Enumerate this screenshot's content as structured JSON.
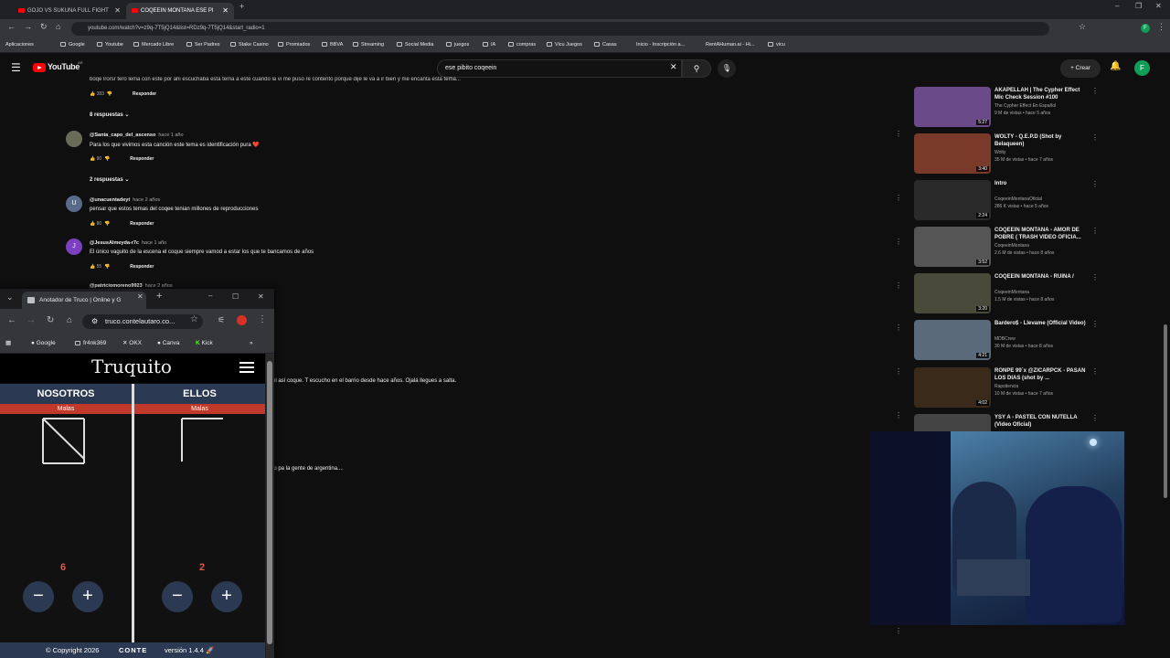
{
  "browser": {
    "tabs": [
      {
        "title": "GOJO VS SUKUNA FULL FIGHT"
      },
      {
        "title": "COQEEIN MONTANA ESE PI"
      }
    ],
    "url": "youtube.com/watch?v=z9q-7T5jQ14&list=RDz9q-7T5jQ14&start_radio=1",
    "bookmarks": [
      "Aplicaciones",
      "Google",
      "Youtube",
      "Mercado Libre",
      "Ser Padres",
      "Stake Casino",
      "Promiados",
      "BBVA",
      "Streaming",
      "Social Media",
      "juegos",
      "IA",
      "compras",
      "Vicu Juegos",
      "Casas",
      "Inicio - Inscripción a...",
      "RentAHuman.ai - Hi...",
      "vicu"
    ]
  },
  "youtube": {
    "logo_text": "YouTube",
    "logo_sup": "AR",
    "search_value": "ese pibito coqeein",
    "create_label": "Crear",
    "avatar_letter": "F",
    "accent": "#ff0000"
  },
  "comments": {
    "truncated_text": "boqe lrorsr tero lema con este por ahi escuchaba esta tema a este cuando la vi me puso re contento porque dije le va a ir bien y me encanta esta tema...",
    "top_likes": "383",
    "reply_label": "Responder",
    "items": [
      {
        "replies_label": "8 respuestas",
        "user": "@Santa_capo_del_ascenso",
        "time": "hace 1 año",
        "text": "Para los que vivimos esta canción este tema es identificación pura ❤️",
        "likes": "90",
        "avatar": "",
        "avatar_color": "#6b6b5a"
      },
      {
        "replies_label": "2 respuestas",
        "user": "@unacuentadeyt",
        "time": "hace 2 años",
        "text": "pensar que estos temas del coqee tenian millones de reproducciones",
        "likes": "80",
        "avatar": "U",
        "avatar_color": "#5a6b8a"
      },
      {
        "replies_label": "",
        "user": "@JesusAlmeyda-r7c",
        "time": "hace 1 año",
        "text": "El único vaguito de la escena el coque siempre vamod a estar los que te bancamos de años",
        "likes": "55",
        "avatar": "J",
        "avatar_color": "#7b3fbf"
      }
    ],
    "partial_user": "@patriciomoreno9923",
    "partial_time": "hace 2 años",
    "snippet_1": "ul así coque.  T escucho en el barrio desde hace años. Ojalá llegues a salta.",
    "snippet_2": "lo pa la gente de argentina...."
  },
  "sidebar": {
    "recs": [
      {
        "title": "AKAPELLAH | The Cypher Effect Mic Check Session #100",
        "channel": "The Cypher Effect En Español",
        "meta": "9 M de vistas • hace 5 años",
        "duration": "5:27",
        "thumb": "#6b4a8a"
      },
      {
        "title": "WOLTY - Q.E.P.D (Shot by Belaqueen)",
        "channel": "Wolty",
        "meta": "35 M de vistas • hace 7 años",
        "duration": "3:40",
        "thumb": "#7a3a2a"
      },
      {
        "title": "Intro",
        "channel": "CoqeeinMontanaOficial",
        "meta": "286 K vistas • hace 5 años",
        "duration": "2:24",
        "thumb": "#2a2a2a"
      },
      {
        "title": "COQEEIN MONTANA - AMOR DE POBRE ( TRASH VIDEO OFICIA...",
        "channel": "CoqeeinMontana",
        "meta": "2.6 M de vistas • hace 8 años",
        "duration": "3:52",
        "thumb": "#555"
      },
      {
        "title": "COQEEIN MONTANA - RUINA /",
        "channel": "CoqeeinMontana",
        "meta": "1.5 M de vistas • hace 8 años",
        "duration": "3:20",
        "thumb": "#4a4a3a"
      },
      {
        "title": "Bardero$ - Llevame (Official Video)",
        "channel": "MDBCrew",
        "meta": "30 M de vistas • hace 8 años",
        "duration": "4:21",
        "thumb": "#5a6a7a"
      },
      {
        "title": "RONPE 99´x @ZICARPCK - PASAN LOS DIAS (shot by ...",
        "channel": "Rapstiencia",
        "meta": "10 M de vistas • hace 7 años",
        "duration": "4:02",
        "thumb": "#3a2a1a"
      },
      {
        "title": "YSY A - PASTEL CON NUTELLA (Video Oficial)",
        "channel": "",
        "meta": "",
        "duration": "",
        "thumb": "#444"
      }
    ]
  },
  "popup": {
    "tab_title": "Anotador de Truco | Online y G",
    "url": "truco.contelautaro.co...",
    "bookmarks": [
      "Google",
      "fr4nk369",
      "OKX",
      "Canva",
      "Kick"
    ],
    "brand": "Truquito",
    "teams": [
      {
        "name": "NOSOTROS",
        "malas_label": "Malas",
        "score": "6"
      },
      {
        "name": "ELLOS",
        "malas_label": "Malas",
        "score": "2"
      }
    ],
    "copyright": "© Copyright 2026",
    "footer_brand": "CONTE",
    "version": "versión 1.4.4 🚀"
  }
}
